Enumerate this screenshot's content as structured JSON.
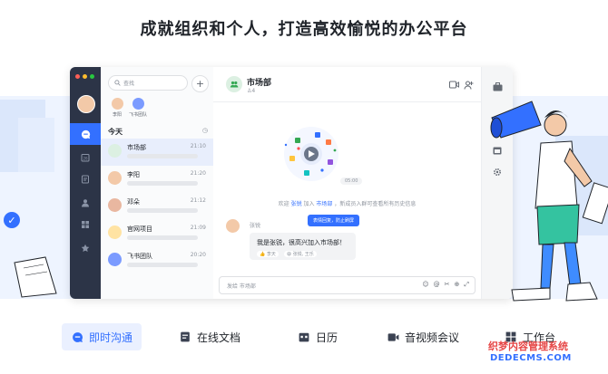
{
  "hero": {
    "title": "成就组织和个人，打造高效愉悦的办公平台"
  },
  "sidebar_list": {
    "search_placeholder": "查找",
    "plus_label": "+",
    "quick": [
      {
        "label": "李阳"
      },
      {
        "label": "飞书团队"
      }
    ],
    "today_label": "今天",
    "items": [
      {
        "name": "市场部",
        "time": "21:10"
      },
      {
        "name": "李阳",
        "time": "21:20"
      },
      {
        "name": "邓朵",
        "time": "21:12"
      },
      {
        "name": "官网项目",
        "time": "21:09"
      },
      {
        "name": "飞书团队",
        "time": "20:20"
      }
    ]
  },
  "chat": {
    "group_name": "市场部",
    "member_count": "4",
    "duration_badge": "05:00",
    "system_message": {
      "prefix": "欢迎 ",
      "user": "张锐",
      "mid": " 加入 ",
      "group": "市场部",
      "suffix": " ，新成员入群可查看所有历史信息"
    },
    "sender_name": "张锐",
    "tooltip": "表情回复，防止刷屏",
    "message_text": "我是张锐，很高兴加入市场部！",
    "reactions": [
      "👍 李天",
      "😄 张锐, 王乐"
    ],
    "composer_placeholder": "发给 市场部"
  },
  "bottom_tabs": [
    {
      "label": "即时沟通",
      "icon": "chat-icon"
    },
    {
      "label": "在线文档",
      "icon": "doc-icon"
    },
    {
      "label": "日历",
      "icon": "calendar-icon"
    },
    {
      "label": "音视频会议",
      "icon": "video-icon"
    },
    {
      "label": "工作台",
      "icon": "grid-icon"
    }
  ],
  "watermark": {
    "line1": "织梦内容管理系统",
    "line2": "DEDECMS.COM"
  },
  "colors": {
    "accent": "#3370ff",
    "nav_dark": "#2c3447",
    "watermark_red": "#e64545"
  }
}
